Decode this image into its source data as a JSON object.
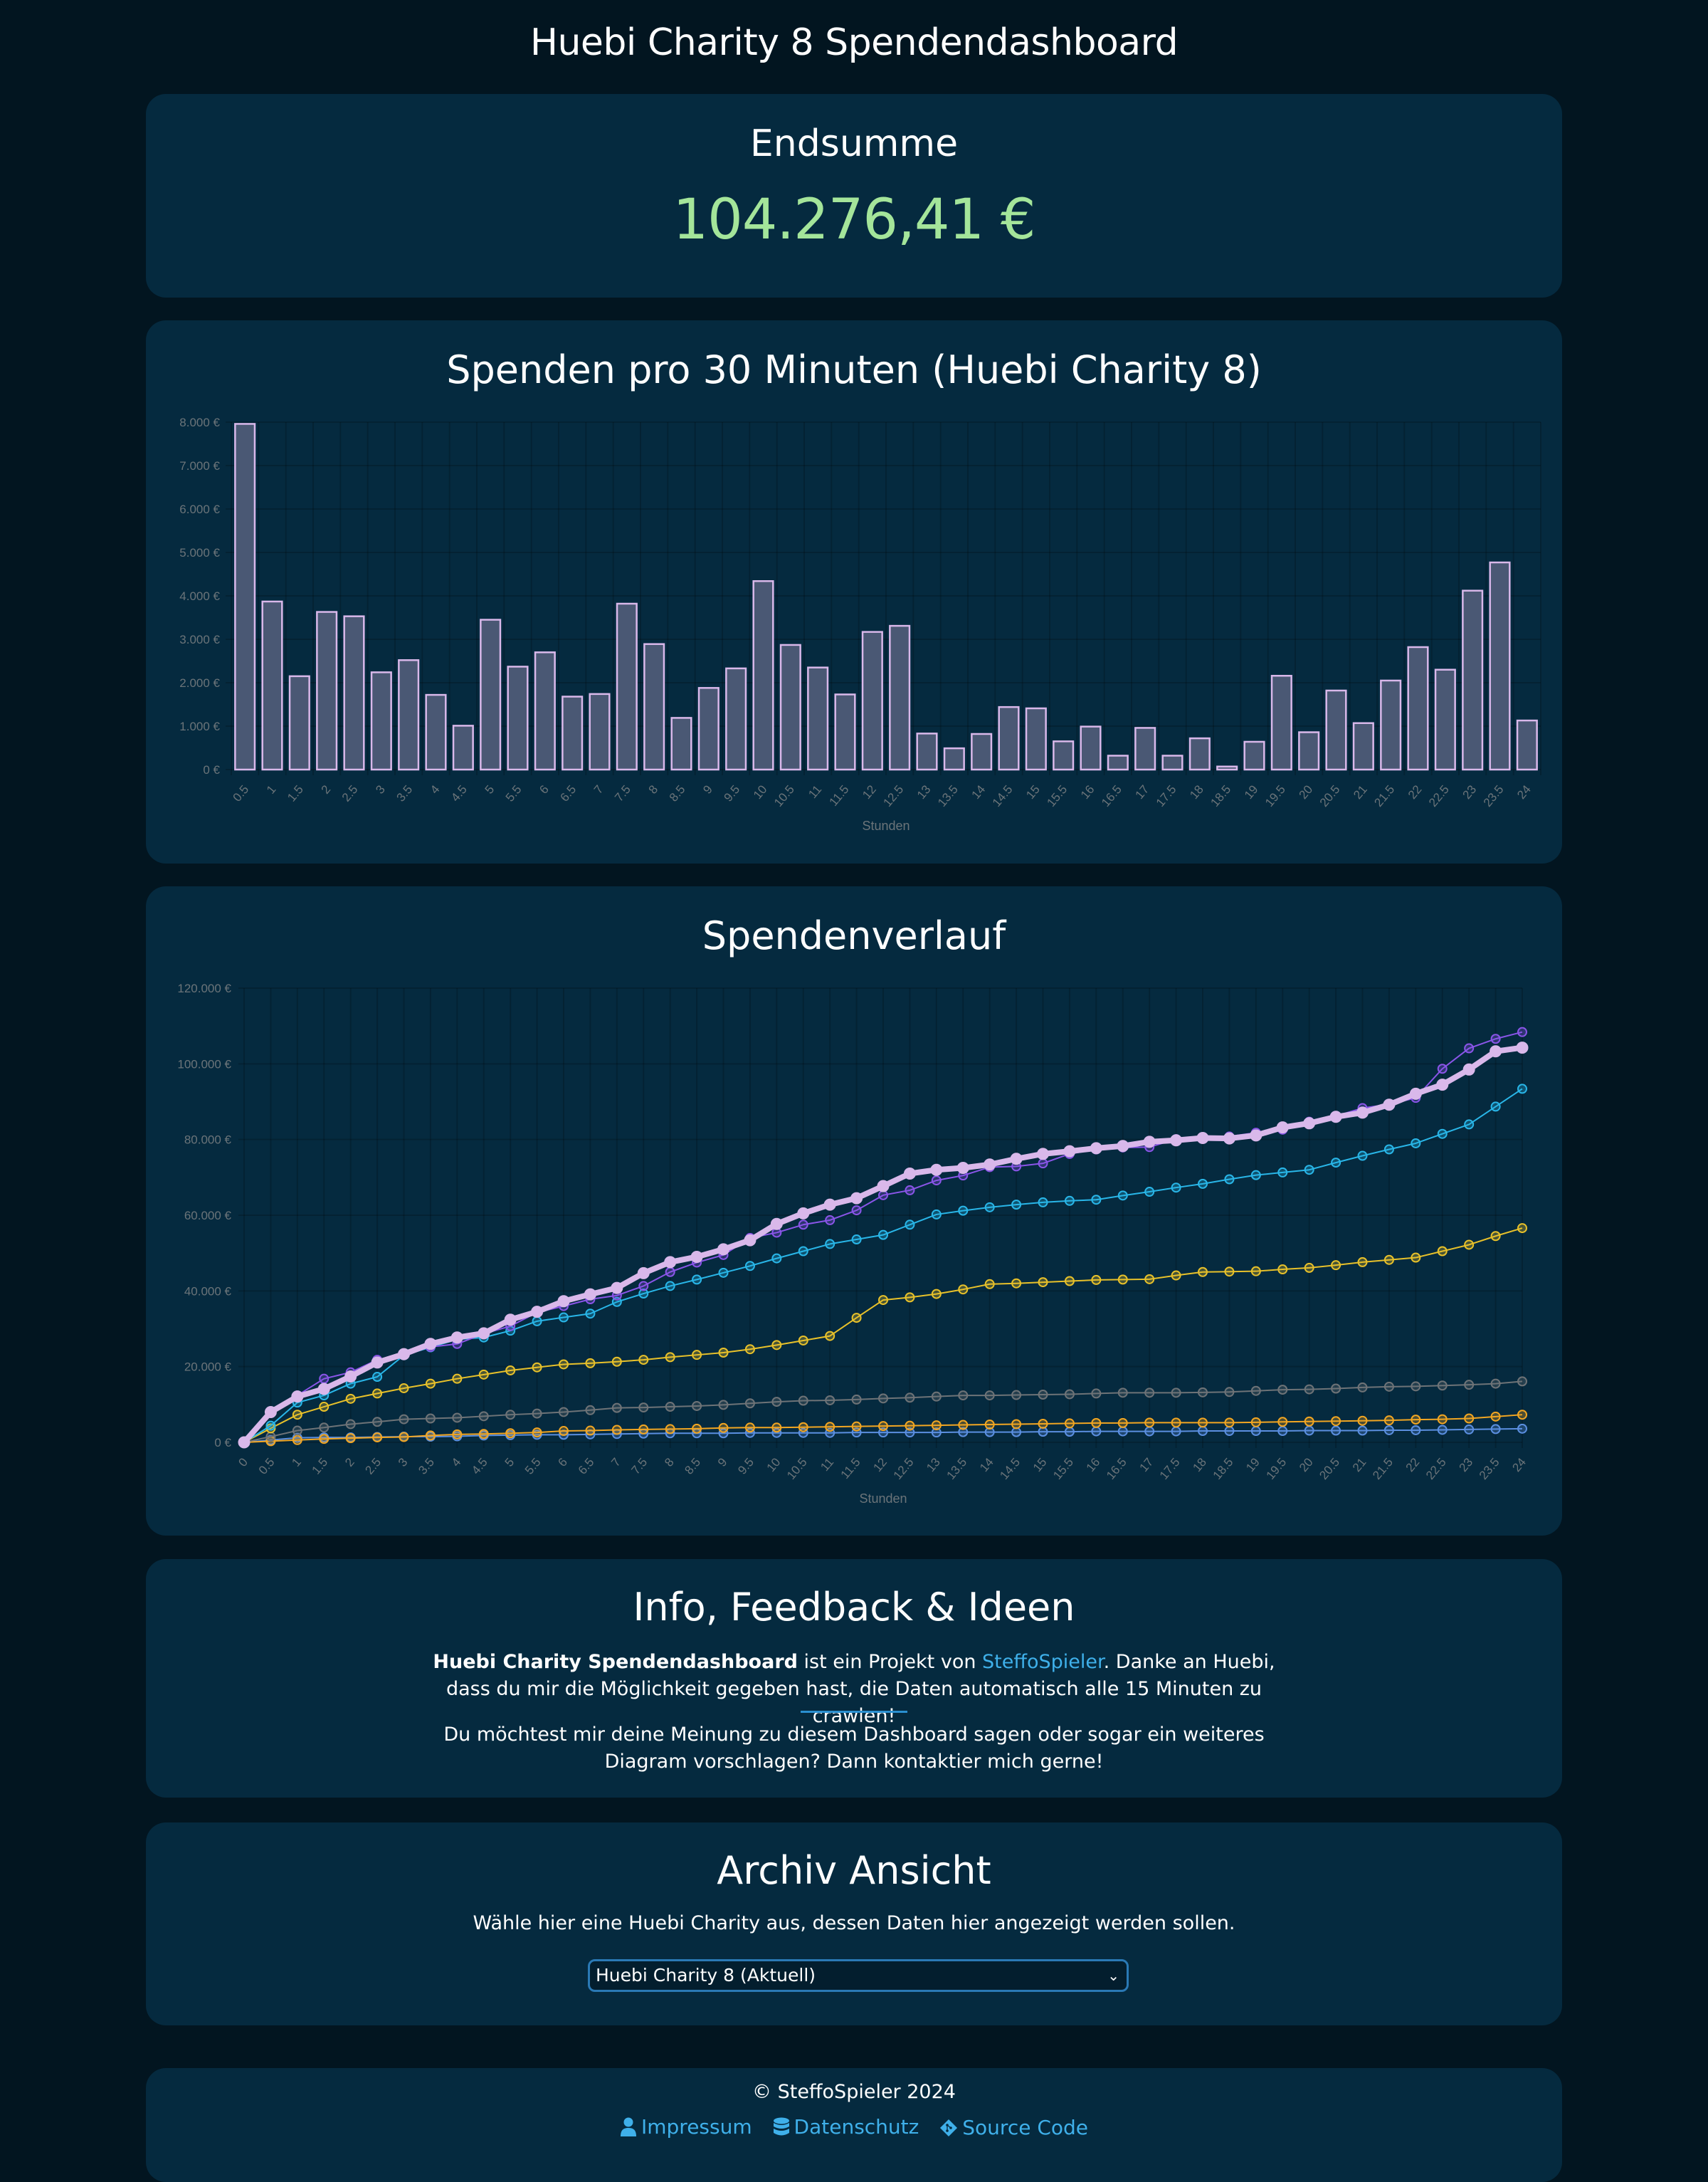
{
  "page": {
    "title": "Huebi Charity 8 Spendendashboard"
  },
  "total": {
    "label": "Endsumme",
    "amount": "104.276,41 €",
    "amount_color": "#a4e59a"
  },
  "bar_section": {
    "title": "Spenden pro 30 Minuten (Huebi Charity 8)"
  },
  "line_section": {
    "title": "Spendenverlauf"
  },
  "chart_data": [
    {
      "type": "bar",
      "title": "Spenden pro 30 Minuten (Huebi Charity 8)",
      "xlabel": "Stunden",
      "ylabel": "",
      "ylim": [
        0,
        8000
      ],
      "yticks": [
        0,
        1000,
        2000,
        3000,
        4000,
        5000,
        6000,
        7000,
        8000
      ],
      "ytick_labels": [
        "0 €",
        "1.000 €",
        "2.000 €",
        "3.000 €",
        "4.000 €",
        "5.000 €",
        "6.000 €",
        "7.000 €",
        "8.000 €"
      ],
      "grid": true,
      "bar_fill": "#4a5874",
      "bar_border": "#d9b8ea",
      "categories": [
        "0.5",
        "1",
        "1.5",
        "2",
        "2.5",
        "3",
        "3.5",
        "4",
        "4.5",
        "5",
        "5.5",
        "6",
        "6.5",
        "7",
        "7.5",
        "8",
        "8.5",
        "9",
        "9.5",
        "10",
        "10.5",
        "11",
        "11.5",
        "12",
        "12.5",
        "13",
        "13.5",
        "14",
        "14.5",
        "15",
        "15.5",
        "16",
        "16.5",
        "17",
        "17.5",
        "18",
        "18.5",
        "19",
        "19.5",
        "20",
        "20.5",
        "21",
        "21.5",
        "22",
        "22.5",
        "23",
        "23.5",
        "24"
      ],
      "values": [
        7960,
        3870,
        2150,
        3630,
        3530,
        2240,
        2520,
        1720,
        1010,
        3450,
        2370,
        2700,
        1680,
        1740,
        3820,
        2890,
        1190,
        1880,
        2330,
        4340,
        2870,
        2350,
        1730,
        3170,
        3310,
        830,
        490,
        820,
        1440,
        1410,
        650,
        990,
        320,
        960,
        320,
        720,
        70,
        640,
        2160,
        860,
        1820,
        1070,
        2050,
        2820,
        2300,
        4120,
        4770,
        1130
      ]
    },
    {
      "type": "line",
      "title": "Spendenverlauf",
      "xlabel": "Stunden",
      "ylabel": "",
      "ylim": [
        0,
        120000
      ],
      "yticks": [
        0,
        20000,
        40000,
        60000,
        80000,
        100000,
        120000
      ],
      "ytick_labels": [
        "0 €",
        "20.000 €",
        "40.000 €",
        "60.000 €",
        "80.000 €",
        "100.000 €",
        "120.000 €"
      ],
      "grid": true,
      "legend": "none",
      "x": [
        "0",
        "0.5",
        "1",
        "1.5",
        "2",
        "2.5",
        "3",
        "3.5",
        "4",
        "4.5",
        "5",
        "5.5",
        "6",
        "6.5",
        "7",
        "7.5",
        "8",
        "8.5",
        "9",
        "9.5",
        "10",
        "10.5",
        "11",
        "11.5",
        "12",
        "12.5",
        "13",
        "13.5",
        "14",
        "14.5",
        "15",
        "15.5",
        "16",
        "16.5",
        "17",
        "17.5",
        "18",
        "18.5",
        "19",
        "19.5",
        "20",
        "20.5",
        "21",
        "21.5",
        "22",
        "22.5",
        "23",
        "23.5",
        "24"
      ],
      "series": [
        {
          "name": "Blue",
          "color": "#5b8fe0",
          "width": "thin",
          "values": [
            0,
            600,
            1200,
            1300,
            1300,
            1400,
            1500,
            1500,
            1600,
            1800,
            1900,
            2000,
            2000,
            2100,
            2200,
            2300,
            2400,
            2400,
            2400,
            2500,
            2500,
            2500,
            2500,
            2600,
            2600,
            2600,
            2600,
            2700,
            2700,
            2700,
            2800,
            2800,
            2900,
            2900,
            2900,
            2900,
            3000,
            3000,
            3000,
            3000,
            3100,
            3100,
            3100,
            3200,
            3200,
            3300,
            3400,
            3500,
            3600
          ]
        },
        {
          "name": "Orange",
          "color": "#f2a622",
          "width": "thin",
          "values": [
            0,
            300,
            600,
            900,
            1100,
            1300,
            1400,
            1800,
            2100,
            2200,
            2400,
            2600,
            3000,
            3100,
            3300,
            3400,
            3500,
            3600,
            3800,
            3900,
            3900,
            4000,
            4100,
            4200,
            4300,
            4400,
            4500,
            4600,
            4700,
            4800,
            4900,
            5000,
            5100,
            5100,
            5200,
            5200,
            5200,
            5200,
            5300,
            5400,
            5500,
            5600,
            5700,
            5800,
            6000,
            6100,
            6300,
            6800,
            7300
          ]
        },
        {
          "name": "Grey",
          "color": "#6e7377",
          "width": "thin",
          "values": [
            0,
            1500,
            3100,
            3900,
            4800,
            5400,
            6100,
            6300,
            6500,
            6900,
            7300,
            7600,
            8000,
            8500,
            9100,
            9200,
            9400,
            9600,
            9900,
            10300,
            10700,
            11000,
            11100,
            11300,
            11600,
            11800,
            12100,
            12400,
            12400,
            12500,
            12600,
            12700,
            12900,
            13100,
            13100,
            13100,
            13200,
            13300,
            13600,
            13900,
            14000,
            14200,
            14500,
            14700,
            14800,
            15000,
            15200,
            15500,
            16100
          ]
        },
        {
          "name": "Yellow",
          "color": "#e8c12a",
          "width": "thin",
          "values": [
            0,
            3700,
            7300,
            9400,
            11500,
            12900,
            14300,
            15500,
            16800,
            17900,
            19000,
            19800,
            20600,
            20900,
            21300,
            21800,
            22500,
            23100,
            23700,
            24600,
            25700,
            26900,
            28100,
            32900,
            37600,
            38300,
            39200,
            40400,
            41800,
            42000,
            42300,
            42600,
            42900,
            43000,
            43100,
            44100,
            45000,
            45100,
            45200,
            45700,
            46100,
            46800,
            47600,
            48200,
            48800,
            50500,
            52200,
            54500,
            56600
          ]
        },
        {
          "name": "Cyan",
          "color": "#29b6e8",
          "width": "thin",
          "values": [
            0,
            4400,
            10500,
            12400,
            15500,
            17300,
            23000,
            25100,
            27200,
            27700,
            29500,
            32000,
            33000,
            34000,
            37100,
            39300,
            41300,
            43000,
            44800,
            46600,
            48600,
            50500,
            52400,
            53600,
            54800,
            57500,
            60200,
            61200,
            62100,
            62800,
            63400,
            63800,
            64100,
            65200,
            66200,
            67300,
            68300,
            69500,
            70600,
            71300,
            72000,
            73900,
            75700,
            77400,
            79000,
            81500,
            84000,
            88700,
            93400
          ]
        },
        {
          "name": "Purple",
          "color": "#8a55e8",
          "width": "thin",
          "values": [
            0,
            8100,
            12400,
            16800,
            18500,
            21800,
            23300,
            25200,
            26000,
            28700,
            30700,
            34300,
            36000,
            37800,
            38800,
            41300,
            45000,
            47500,
            49500,
            54000,
            55400,
            57500,
            58700,
            61300,
            65300,
            66600,
            69200,
            70500,
            72700,
            72900,
            73700,
            76200,
            77400,
            77900,
            78000,
            80100,
            80500,
            80800,
            81800,
            82600,
            84700,
            86200,
            88300,
            89300,
            91000,
            98700,
            104100,
            106600,
            108400
          ]
        },
        {
          "name": "Huebi Charity 8",
          "color": "#d9b8ea",
          "width": "thick",
          "values": [
            0,
            8000,
            12100,
            14100,
            17400,
            21100,
            23300,
            26000,
            27700,
            28800,
            32400,
            34500,
            37300,
            39100,
            40800,
            44700,
            47600,
            49000,
            51000,
            53400,
            57700,
            60500,
            62800,
            64500,
            67700,
            71000,
            72000,
            72500,
            73400,
            74900,
            76200,
            76900,
            77700,
            78300,
            79400,
            79800,
            80400,
            80300,
            81100,
            83200,
            84300,
            86000,
            87100,
            89200,
            92100,
            94500,
            98500,
            103300,
            104276
          ]
        }
      ]
    }
  ],
  "info": {
    "title": "Info, Feedback & Ideen",
    "p1_bold": "Huebi Charity Spendendashboard",
    "p1_pre_link": " ist ein Projekt von ",
    "p1_link": "SteffoSpieler",
    "p1_post_link": ". Danke an Huebi, dass du mir die Möglichkeit gegeben hast, die Daten automatisch alle 15 Minuten zu crawlen!",
    "p2": "Du möchtest mir deine Meinung zu diesem Dashboard sagen oder sogar ein weiteres Diagram vorschlagen? Dann kontaktier mich gerne!"
  },
  "archive": {
    "title": "Archiv Ansicht",
    "description": "Wähle hier eine Huebi Charity aus, dessen Daten hier angezeigt werden sollen.",
    "selected": "Huebi Charity 8 (Aktuell)"
  },
  "footer": {
    "copyright": "© SteffoSpieler 2024",
    "links": [
      {
        "label": "Impressum",
        "icon": "user-icon"
      },
      {
        "label": "Datenschutz",
        "icon": "database-icon"
      },
      {
        "label": "Source Code",
        "icon": "git-icon"
      }
    ],
    "link_color": "#3fb0ea"
  }
}
